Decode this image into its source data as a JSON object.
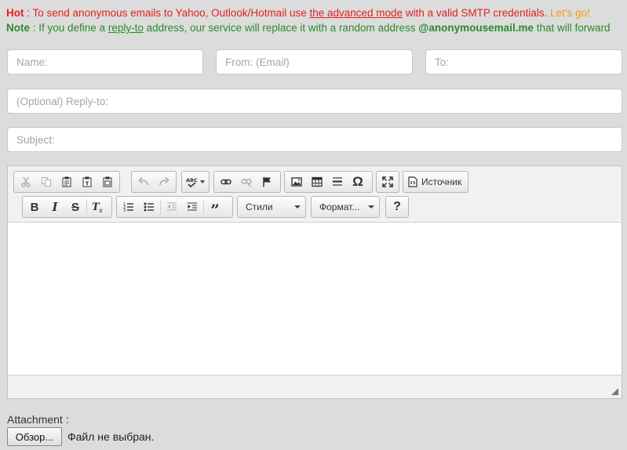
{
  "notices": {
    "hot": {
      "label": "Hot",
      "sep": " : ",
      "text1": "To send anonymous emails to Yahoo, Outlook/Hotmail use ",
      "link": "the advanced mode",
      "text2": " with a valid SMTP credentials. ",
      "cta": "Let's go!"
    },
    "note": {
      "label": "Note",
      "sep": " : ",
      "text1": "If you define a ",
      "link": "reply-to",
      "text2": " address, our service will replace it with a random address ",
      "domain": "@anonymousemail.me",
      "text3": " that will forward"
    }
  },
  "form": {
    "name_placeholder": "Name:",
    "from_placeholder": "From: (Email)",
    "to_placeholder": "To:",
    "replyto_placeholder": "(Optional) Reply-to:",
    "subject_placeholder": "Subject:"
  },
  "editor": {
    "source_label": "Источник",
    "styles_label": "Стили",
    "format_label": "Формат...",
    "help_label": "?"
  },
  "attachment": {
    "label": "Attachment :",
    "browse_label": "Обзор...",
    "status": "Файл не выбран."
  }
}
